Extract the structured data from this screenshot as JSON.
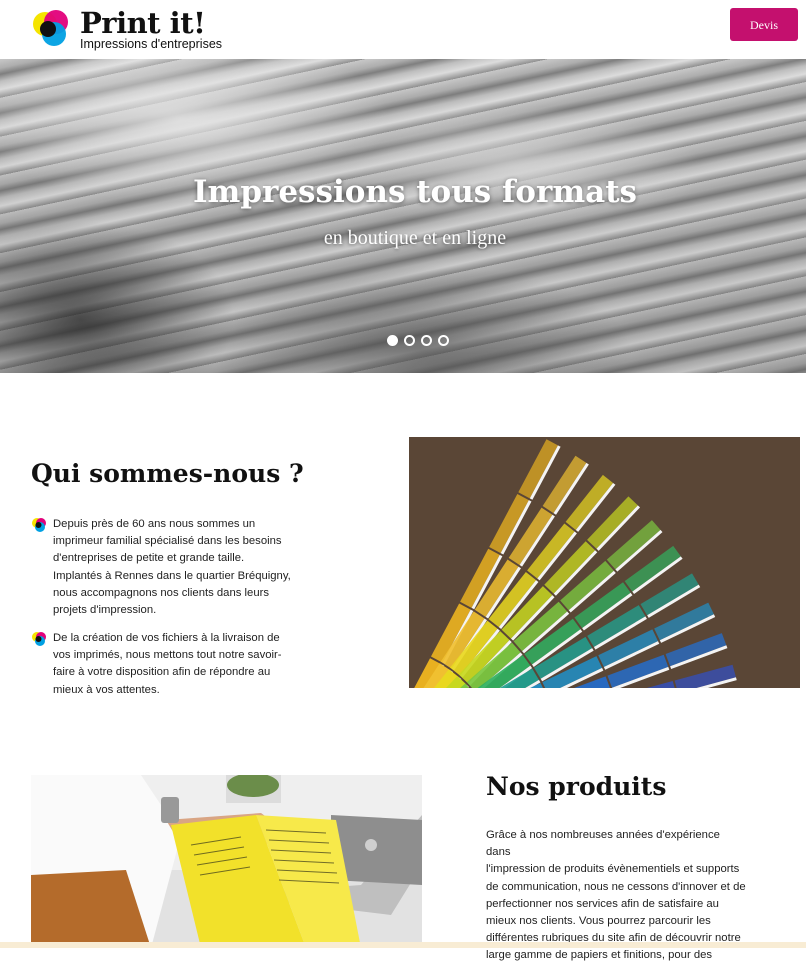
{
  "header": {
    "brand_name": "Print it!",
    "brand_tagline": "Impressions d'entreprises",
    "devis_label": "Devis",
    "accent_color": "#c4106e"
  },
  "hero": {
    "title": "Impressions tous formats",
    "subtitle": "en boutique et en ligne",
    "slides_count": 4,
    "active_slide": 1
  },
  "about": {
    "heading": "Qui sommes-nous ?",
    "bullets": [
      [
        "Depuis près de 60 ans nous sommes un",
        "imprimeur familial spécialisé dans les besoins",
        "d'entreprises de petite et grande taille.",
        "Implantés à Rennes dans le quartier Bréquigny,",
        "nous accompagnons nos clients dans leurs",
        "projets d'impression."
      ],
      [
        "De la création de vos fichiers à la livraison de",
        "vos imprimés, nous mettons tout notre savoir-",
        "faire à votre disposition afin de répondre au",
        "mieux à vos attentes."
      ]
    ],
    "image": "color-swatch-fan-photo"
  },
  "products": {
    "heading": "Nos produits",
    "lines": [
      "Grâce à nos nombreuses années d'expérience dans",
      "l'impression de produits évènementiels et supports",
      "de communication, nous ne cessons d'innover et de",
      "perfectionner nos services afin de satisfaire au",
      "mieux nos clients. Vous pourrez parcourir les",
      "différentes rubriques du site afin de découvrir notre",
      "large gamme de papiers et finitions, pour des"
    ],
    "image": "person-reading-brochure-photo"
  }
}
